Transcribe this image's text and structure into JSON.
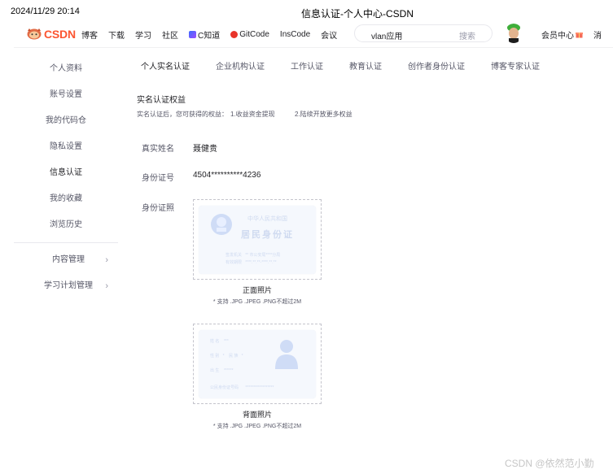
{
  "print": {
    "date": "2024/11/29 20:14",
    "title": "信息认证-个人中心-CSDN"
  },
  "header": {
    "logo_text": "CSDN",
    "nav": [
      {
        "label": "博客",
        "icon": ""
      },
      {
        "label": "下载",
        "icon": ""
      },
      {
        "label": "学习",
        "icon": ""
      },
      {
        "label": "社区",
        "icon": ""
      },
      {
        "label": "C知道",
        "icon": "c-zhidao-icon"
      },
      {
        "label": "GitCode",
        "icon": "gitcode-icon"
      },
      {
        "label": "InsCode",
        "icon": ""
      },
      {
        "label": "会议",
        "icon": ""
      }
    ],
    "search_value": "vlan应用",
    "search_button": "搜索",
    "member_center": "会员中心",
    "messages": "消"
  },
  "sidebar": {
    "items": [
      {
        "label": "个人资料",
        "active": false
      },
      {
        "label": "账号设置",
        "active": false
      },
      {
        "label": "我的代码仓",
        "active": false
      },
      {
        "label": "隐私设置",
        "active": false
      },
      {
        "label": "信息认证",
        "active": true
      },
      {
        "label": "我的收藏",
        "active": false
      },
      {
        "label": "浏览历史",
        "active": false
      }
    ],
    "groups": [
      {
        "label": "内容管理"
      },
      {
        "label": "学习计划管理"
      }
    ]
  },
  "tabs": [
    {
      "label": "个人实名认证",
      "active": true
    },
    {
      "label": "企业机构认证",
      "active": false
    },
    {
      "label": "工作认证",
      "active": false
    },
    {
      "label": "教育认证",
      "active": false
    },
    {
      "label": "创作者身份认证",
      "active": false
    },
    {
      "label": "博客专家认证",
      "active": false
    }
  ],
  "rights": {
    "title": "实名认证权益",
    "prefix": "实名认证后，您可获得的权益：",
    "item1": "1.收益资金提现",
    "item2": "2.陆续开放更多权益"
  },
  "fields": {
    "name_label": "真实姓名",
    "name_value": "聂健贵",
    "id_label": "身份证号",
    "id_value": "4504**********4236",
    "photo_label": "身份证照"
  },
  "id_front": {
    "card_title": "中华人民共和国",
    "card_subtitle": "居民身份证",
    "line1_label": "签发机关",
    "line1_value": "** 市公安局****分局",
    "line2_label": "有效期限",
    "line2_value": "****.**.**-****.**.**",
    "caption": "正面照片",
    "hint": "* 支持 .JPG .JPEG .PNG不超过2M"
  },
  "id_back": {
    "row1_label": "姓 名",
    "row1_value": "***",
    "row2_label": "性 别",
    "row2_value": "*",
    "row2b_label": "民 族",
    "row2b_value": "*",
    "row3_label": "出 生",
    "row3_value": "******",
    "row4_label": "公民身份证号码",
    "row4_value": "******************",
    "caption": "背面照片",
    "hint": "* 支持 .JPG .JPEG .PNG不超过2M"
  },
  "watermark": "CSDN @依然范小勤",
  "colors": {
    "brand": "#fc5531",
    "card_bg": "#f5f8fd",
    "card_text": "#cfdaf0"
  }
}
